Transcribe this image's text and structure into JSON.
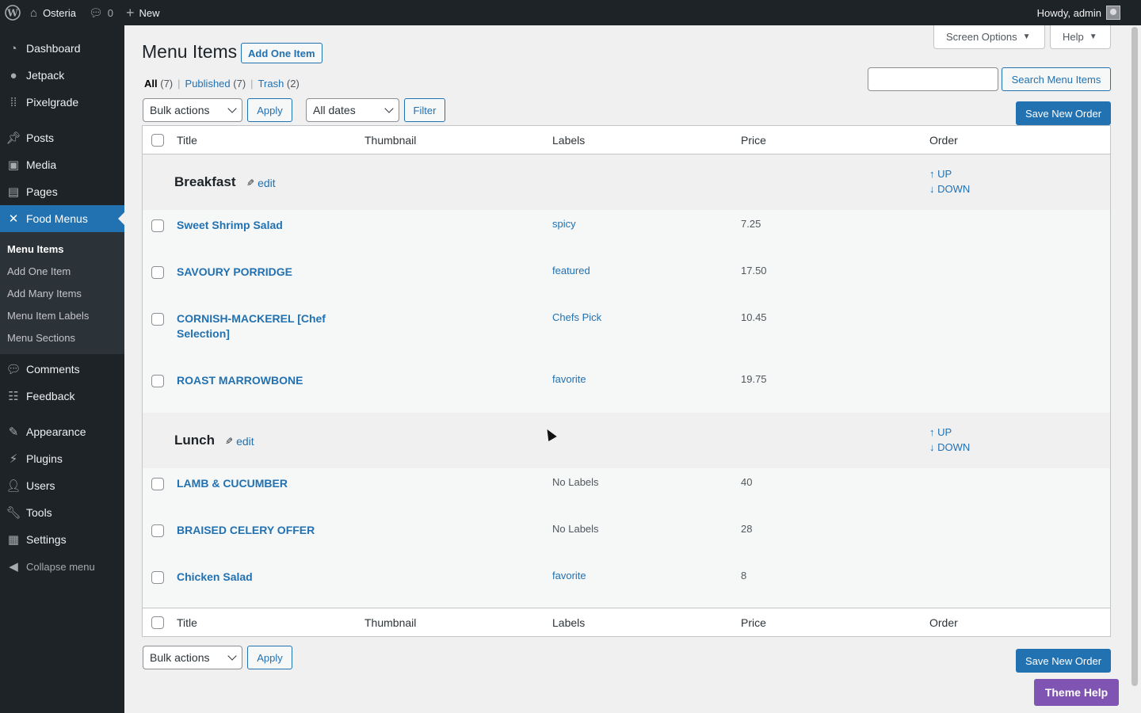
{
  "adminbar": {
    "site_name": "Osteria",
    "comments_count": "0",
    "new_label": "New",
    "howdy": "Howdy, admin"
  },
  "sidebar": {
    "items": [
      {
        "label": "Dashboard",
        "icon": "dashboard-icon"
      },
      {
        "label": "Jetpack",
        "icon": "jetpack-icon"
      },
      {
        "label": "Pixelgrade",
        "icon": "pixelgrade-icon"
      },
      {
        "label": "Posts",
        "icon": "pin-icon"
      },
      {
        "label": "Media",
        "icon": "media-icon"
      },
      {
        "label": "Pages",
        "icon": "pages-icon"
      },
      {
        "label": "Food Menus",
        "icon": "utensils-icon"
      },
      {
        "label": "Comments",
        "icon": "comments-icon"
      },
      {
        "label": "Feedback",
        "icon": "feedback-icon"
      },
      {
        "label": "Appearance",
        "icon": "brush-icon"
      },
      {
        "label": "Plugins",
        "icon": "plugin-icon"
      },
      {
        "label": "Users",
        "icon": "user-icon"
      },
      {
        "label": "Tools",
        "icon": "wrench-icon"
      },
      {
        "label": "Settings",
        "icon": "settings-icon"
      }
    ],
    "submenu": [
      "Menu Items",
      "Add One Item",
      "Add Many Items",
      "Menu Item Labels",
      "Menu Sections"
    ],
    "collapse_label": "Collapse menu"
  },
  "screen_options": "Screen Options",
  "help": "Help",
  "page": {
    "title": "Menu Items",
    "add_one": "Add One Item"
  },
  "views": {
    "all": "All",
    "all_count": "(7)",
    "published": "Published",
    "published_count": "(7)",
    "trash": "Trash",
    "trash_count": "(2)"
  },
  "search_button": "Search Menu Items",
  "bulk_actions": "Bulk actions",
  "apply": "Apply",
  "all_dates": "All dates",
  "filter": "Filter",
  "save_order": "Save New Order",
  "columns": {
    "title": "Title",
    "thumbnail": "Thumbnail",
    "labels": "Labels",
    "price": "Price",
    "order": "Order"
  },
  "edit_label": "edit",
  "up_label": "↑ UP",
  "down_label": "↓ DOWN",
  "sections": [
    {
      "name": "Breakfast",
      "items": [
        {
          "title": "Sweet Shrimp Salad",
          "labels": "spicy",
          "price": "7.25"
        },
        {
          "title": "SAVOURY PORRIDGE",
          "labels": "featured",
          "price": "17.50"
        },
        {
          "title": "CORNISH-MACKEREL [Chef Selection]",
          "labels": "Chefs Pick",
          "price": "10.45"
        },
        {
          "title": "ROAST MARROWBONE",
          "labels": "favorite",
          "price": "19.75"
        }
      ]
    },
    {
      "name": "Lunch",
      "items": [
        {
          "title": "LAMB & CUCUMBER",
          "labels": "No Labels",
          "price": "40"
        },
        {
          "title": "BRAISED CELERY OFFER",
          "labels": "No Labels",
          "price": "28"
        },
        {
          "title": "Chicken Salad",
          "labels": "favorite",
          "price": "8"
        }
      ]
    }
  ],
  "theme_help": "Theme Help",
  "colors": {
    "accent": "#2271b1",
    "sidebar_bg": "#1d2327",
    "theme_help": "#7f54b3"
  }
}
